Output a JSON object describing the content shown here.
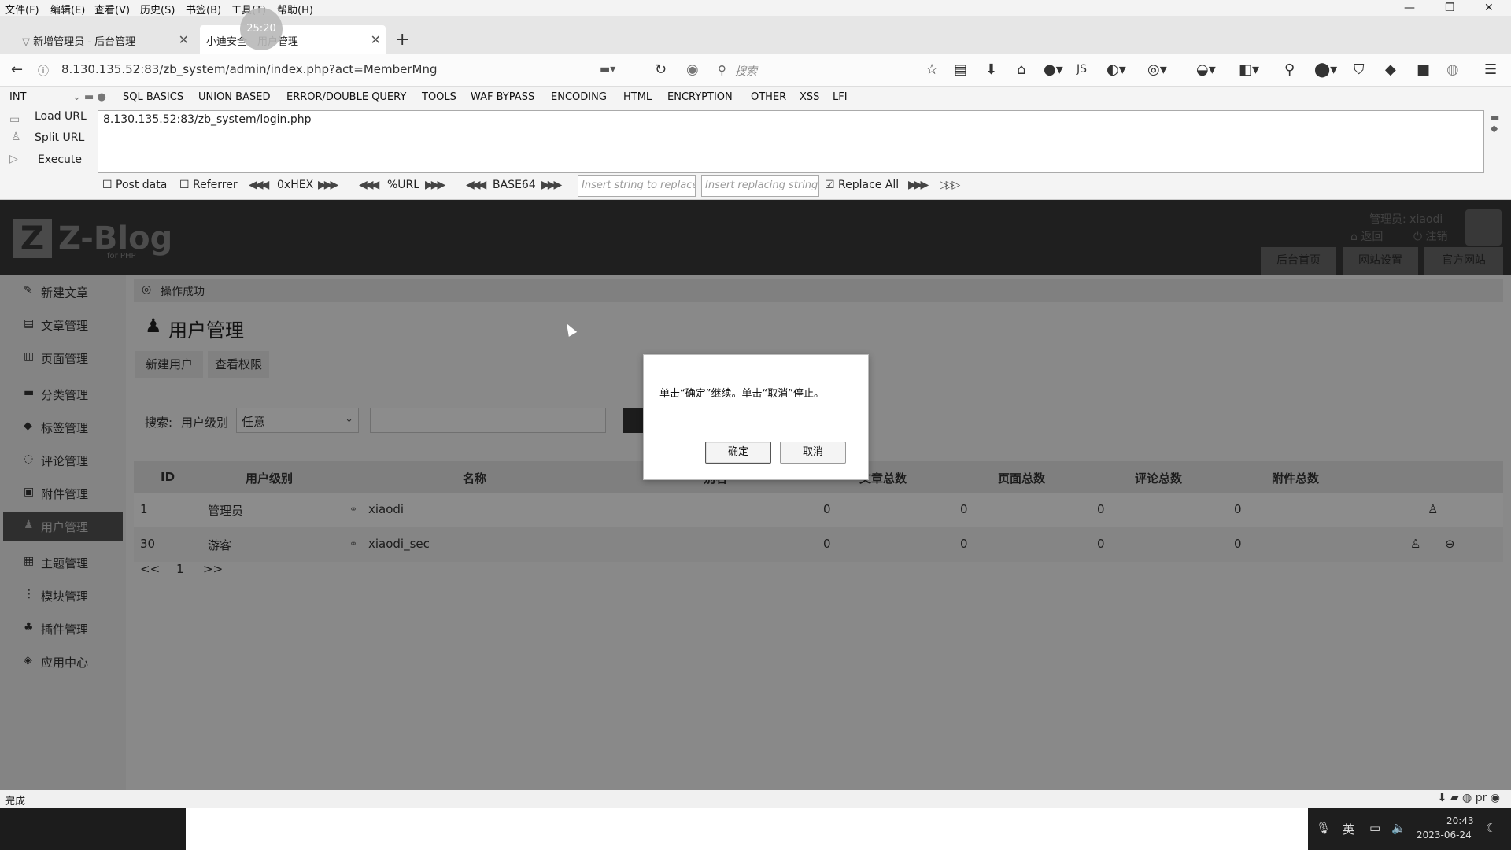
{
  "menubar": {
    "items": [
      "文件(F)",
      "编辑(E)",
      "查看(V)",
      "历史(S)",
      "书签(B)",
      "工具(T)",
      "帮助(H)"
    ],
    "win_min": "—",
    "win_restore": "❐",
    "win_close": "✕"
  },
  "tabs": [
    {
      "title": "新增管理员 - 后台管理",
      "active": false
    },
    {
      "title": "小迪安全 - 用户管理",
      "active": true
    }
  ],
  "recording_badge": "25:20",
  "nav": {
    "url": "8.130.135.52:83/zb_system/admin/index.php?act=MemberMng",
    "search_placeholder": "搜索"
  },
  "hackbar": {
    "type_select": "INT",
    "menus": [
      "SQL BASICS",
      "UNION BASED",
      "ERROR/DOUBLE QUERY",
      "TOOLS",
      "WAF BYPASS",
      "ENCODING",
      "HTML",
      "ENCRYPTION",
      "OTHER",
      "XSS",
      "LFI"
    ],
    "load_url": "Load URL",
    "split_url": "Split URL",
    "execute": "Execute",
    "url_value": "8.130.135.52:83/zb_system/login.php",
    "post_data": "Post data",
    "referrer": "Referrer",
    "hex": "0xHEX",
    "urlenc": "%URL",
    "base64": "BASE64",
    "replace_placeholder": "Insert string to replace",
    "replacing_placeholder": "Insert replacing string",
    "replace_all": "Replace All"
  },
  "site": {
    "logo_text": "Z-Blog",
    "logo_sub": "for PHP",
    "admin_label": "管理员: xiaodi",
    "back": "返回",
    "logout": "注销",
    "top_tabs": [
      "后台首页",
      "网站设置",
      "官方网站"
    ]
  },
  "sidebar": {
    "items": [
      {
        "label": "新建文章",
        "icon": "edit-icon"
      },
      {
        "label": "文章管理",
        "icon": "article-icon"
      },
      {
        "label": "页面管理",
        "icon": "page-icon"
      },
      {
        "label": "分类管理",
        "icon": "folder-icon"
      },
      {
        "label": "标签管理",
        "icon": "tag-icon"
      },
      {
        "label": "评论管理",
        "icon": "comment-icon"
      },
      {
        "label": "附件管理",
        "icon": "attachment-icon"
      },
      {
        "label": "用户管理",
        "icon": "user-icon",
        "active": true
      },
      {
        "label": "主题管理",
        "icon": "theme-icon"
      },
      {
        "label": "模块管理",
        "icon": "module-icon"
      },
      {
        "label": "插件管理",
        "icon": "plugin-icon"
      },
      {
        "label": "应用中心",
        "icon": "app-center-icon"
      }
    ]
  },
  "main": {
    "message": "操作成功",
    "title": "用户管理",
    "buttons": [
      "新建用户",
      "查看权限"
    ],
    "search_label": "搜索:",
    "level_label": "用户级别",
    "level_value": "任意",
    "columns": [
      "ID",
      "用户级别",
      "名称",
      "别名",
      "文章总数",
      "页面总数",
      "评论总数",
      "附件总数"
    ],
    "rows": [
      {
        "id": "1",
        "level": "管理员",
        "name": "xiaodi",
        "alias": "",
        "articles": "0",
        "pages": "0",
        "comments": "0",
        "attachments": "0"
      },
      {
        "id": "30",
        "level": "游客",
        "name": "xiaodi_sec",
        "alias": "",
        "articles": "0",
        "pages": "0",
        "comments": "0",
        "attachments": "0"
      }
    ],
    "pager": [
      "<<",
      "1",
      ">>"
    ]
  },
  "dialog": {
    "message": "单击“确定”继续。单击“取消”停止。",
    "ok": "确定",
    "cancel": "取消"
  },
  "status": {
    "text": "完成"
  },
  "taskbar": {
    "ime": "英",
    "time": "20:43",
    "date": "2023-06-24"
  }
}
